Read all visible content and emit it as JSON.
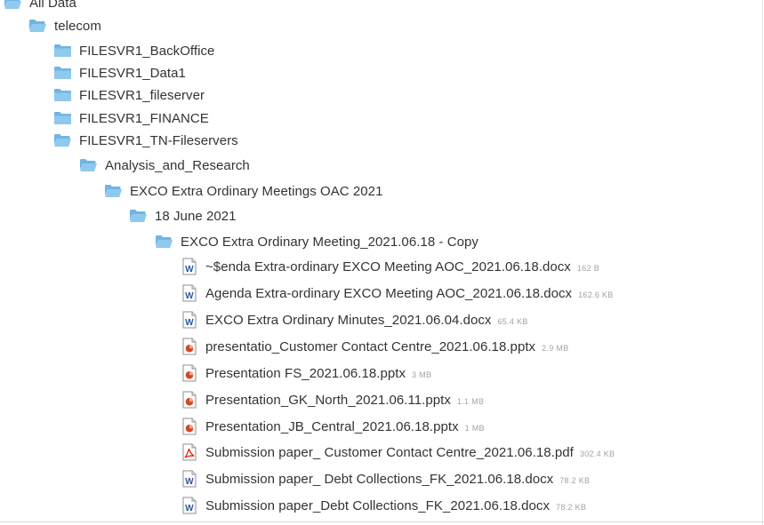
{
  "tree": {
    "folders": [
      {
        "label": "All Data",
        "icon": "folder-open-icon"
      },
      {
        "label": "telecom",
        "icon": "folder-open-icon"
      },
      {
        "label": "FILESVR1_BackOffice",
        "icon": "folder-icon"
      },
      {
        "label": "FILESVR1_Data1",
        "icon": "folder-icon"
      },
      {
        "label": "FILESVR1_fileserver",
        "icon": "folder-icon"
      },
      {
        "label": "FILESVR1_FINANCE",
        "icon": "folder-icon"
      },
      {
        "label": "FILESVR1_TN-Fileservers",
        "icon": "folder-open-icon"
      },
      {
        "label": "Analysis_and_Research",
        "icon": "folder-open-icon"
      },
      {
        "label": "EXCO Extra Ordinary Meetings OAC 2021",
        "icon": "folder-open-icon"
      },
      {
        "label": "18 June 2021",
        "icon": "folder-open-icon"
      },
      {
        "label": "EXCO Extra Ordinary Meeting_2021.06.18 - Copy",
        "icon": "folder-open-icon"
      }
    ],
    "files": [
      {
        "label": "~$enda Extra-ordinary EXCO Meeting AOC_2021.06.18.docx",
        "size": "162 B",
        "type": "word-document-icon"
      },
      {
        "label": "Agenda Extra-ordinary EXCO Meeting AOC_2021.06.18.docx",
        "size": "162.6 KB",
        "type": "word-document-icon"
      },
      {
        "label": "EXCO Extra Ordinary Minutes_2021.06.04.docx",
        "size": "65.4 KB",
        "type": "word-document-icon"
      },
      {
        "label": "presentatio_Customer Contact Centre_2021.06.18.pptx",
        "size": "2.9 MB",
        "type": "powerpoint-icon"
      },
      {
        "label": "Presentation FS_2021.06.18.pptx",
        "size": "3 MB",
        "type": "powerpoint-icon"
      },
      {
        "label": "Presentation_GK_North_2021.06.11.pptx",
        "size": "1.1 MB",
        "type": "powerpoint-icon"
      },
      {
        "label": "Presentation_JB_Central_2021.06.18.pptx",
        "size": "1 MB",
        "type": "powerpoint-icon"
      },
      {
        "label": "Submission paper_ Customer Contact Centre_2021.06.18.pdf",
        "size": "302.4 KB",
        "type": "pdf-icon"
      },
      {
        "label": "Submission paper_ Debt Collections_FK_2021.06.18.docx",
        "size": "78.2 KB",
        "type": "word-document-icon"
      },
      {
        "label": "Submission paper_Debt Collections_FK_2021.06.18.docx",
        "size": "78.2 KB",
        "type": "word-document-icon"
      }
    ]
  },
  "colors": {
    "folder": "#8fc9ee",
    "folder_dark": "#6fb5e3",
    "word": "#2b579a",
    "powerpoint": "#d24726",
    "pdf": "#e0241b",
    "text": "#333333",
    "size_text": "#a3a3a3"
  }
}
